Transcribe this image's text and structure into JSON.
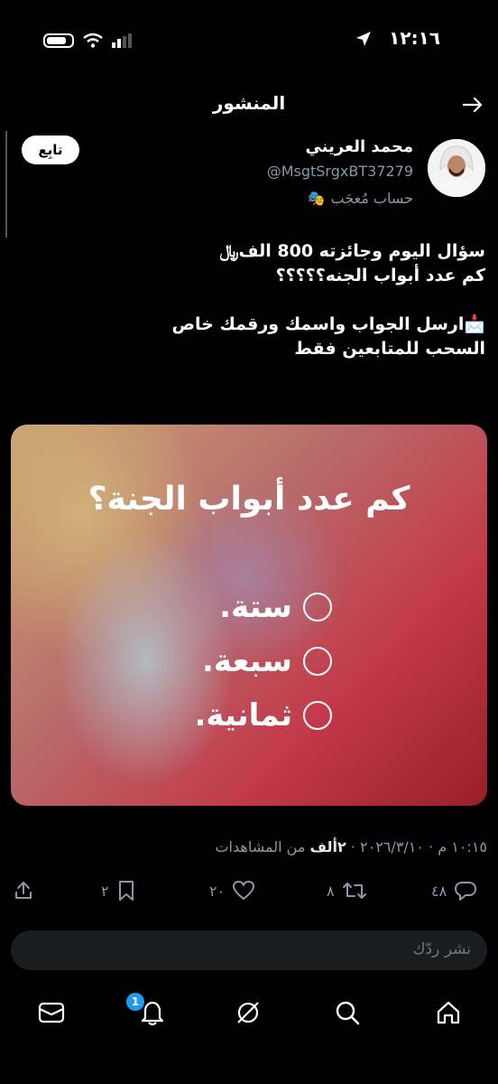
{
  "status": {
    "time": "١٢:١٦"
  },
  "header": {
    "title": "المنشور"
  },
  "author": {
    "name": "محمد العريني",
    "handle": "@MsgtSrgxBT37279",
    "badge_emoji": "🎭",
    "badge_text": "حساب مُعجَب",
    "follow_label": "تابِع"
  },
  "tweet": {
    "text": "سؤال اليوم وجائزته 800 الف﷼\nكم عدد أبواب الجنه؟؟؟؟؟\n\n📩ارسل الجواب واسمك ورقمك خاص\nالسحب للمتابعين فقط"
  },
  "image": {
    "question": "كم عدد أبواب الجنة؟",
    "options": [
      "ستة.",
      "سبعة.",
      "ثمانية."
    ]
  },
  "meta": {
    "timestamp": "١٠:١٥ م · ٢٠٢٦/٣/١٠",
    "separator": " · ",
    "views_count": "٢ألف",
    "views_label": " من المشاهدات"
  },
  "actions": {
    "replies": "٤٨",
    "reposts": "٨",
    "likes": "٢٠",
    "bookmarks": "٢"
  },
  "reply_box": {
    "placeholder": "نشر ردّك"
  },
  "nav": {
    "notifications_badge": "1"
  },
  "colors": {
    "accent": "#1d9bf0",
    "muted": "#8b98a5",
    "background": "#000000"
  }
}
